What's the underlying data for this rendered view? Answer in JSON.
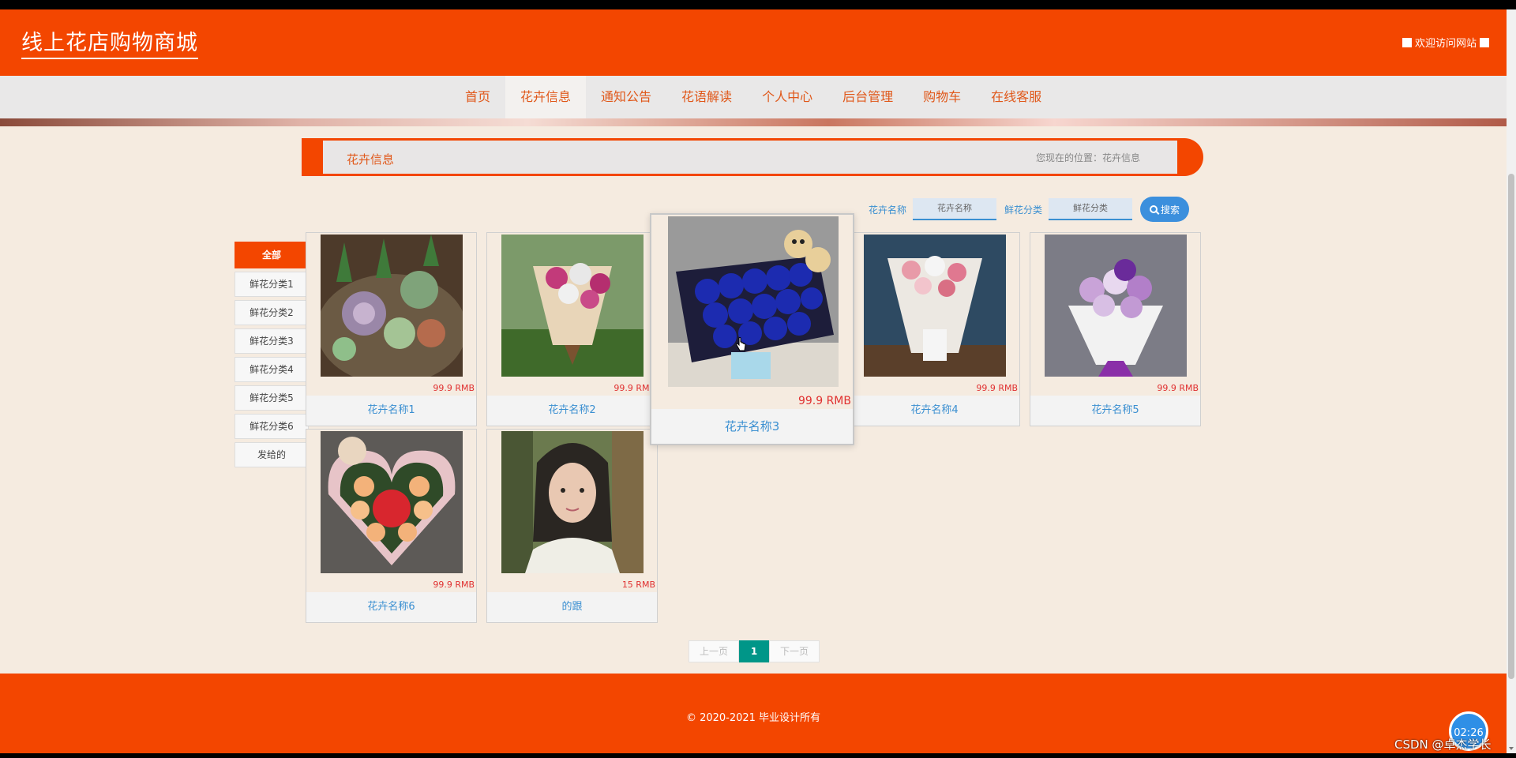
{
  "header": {
    "site_title": "线上花店购物商城",
    "welcome": "欢迎访问网站"
  },
  "nav": {
    "items": [
      "首页",
      "花卉信息",
      "通知公告",
      "花语解读",
      "个人中心",
      "后台管理",
      "购物车",
      "在线客服"
    ],
    "active": "花卉信息"
  },
  "crumb": {
    "title": "花卉信息",
    "location": "您现在的位置：花卉信息"
  },
  "search": {
    "name_label": "花卉名称",
    "name_placeholder": "花卉名称",
    "category_label": "鲜花分类",
    "category_placeholder": "鲜花分类",
    "button": "搜索"
  },
  "categories": [
    "全部",
    "鲜花分类1",
    "鲜花分类2",
    "鲜花分类3",
    "鲜花分类4",
    "鲜花分类5",
    "鲜花分类6",
    "发给的"
  ],
  "products": [
    {
      "name": "花卉名称1",
      "price": "99.9 RMB",
      "image": "succulent-plants"
    },
    {
      "name": "花卉名称2",
      "price": "99.9 RMB",
      "image": "pink-rose-bouquet"
    },
    {
      "name": "花卉名称3",
      "price": "99.9 RMB",
      "image": "blue-rose-box-with-bears"
    },
    {
      "name": "花卉名称4",
      "price": "99.9 RMB",
      "image": "pink-white-bouquet"
    },
    {
      "name": "花卉名称5",
      "price": "99.9 RMB",
      "image": "purple-rose-bouquet"
    },
    {
      "name": "花卉名称6",
      "price": "99.9 RMB",
      "image": "heart-box-roses-apple"
    },
    {
      "name": "的跟",
      "price": "15 RMB",
      "image": "woman-portrait"
    }
  ],
  "pager": {
    "prev": "上一页",
    "current": "1",
    "next": "下一页"
  },
  "footer": {
    "copyright": "© 2020-2021 毕业设计所有"
  },
  "overlay": {
    "timer": "02:26",
    "watermark": "CSDN @卓杰学长"
  },
  "colors": {
    "brand": "#f34600",
    "link": "#3a8fd1",
    "price": "#e03030",
    "pager_active": "#009688"
  }
}
